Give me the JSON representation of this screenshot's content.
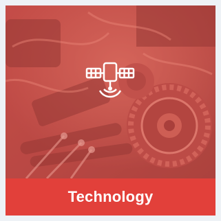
{
  "card": {
    "title": "Technology",
    "icon": "satellite-signal-icon",
    "overlay_color": "#e2534c",
    "caption_bar_color": "#e2403a",
    "page_background": "#eef2f6"
  }
}
